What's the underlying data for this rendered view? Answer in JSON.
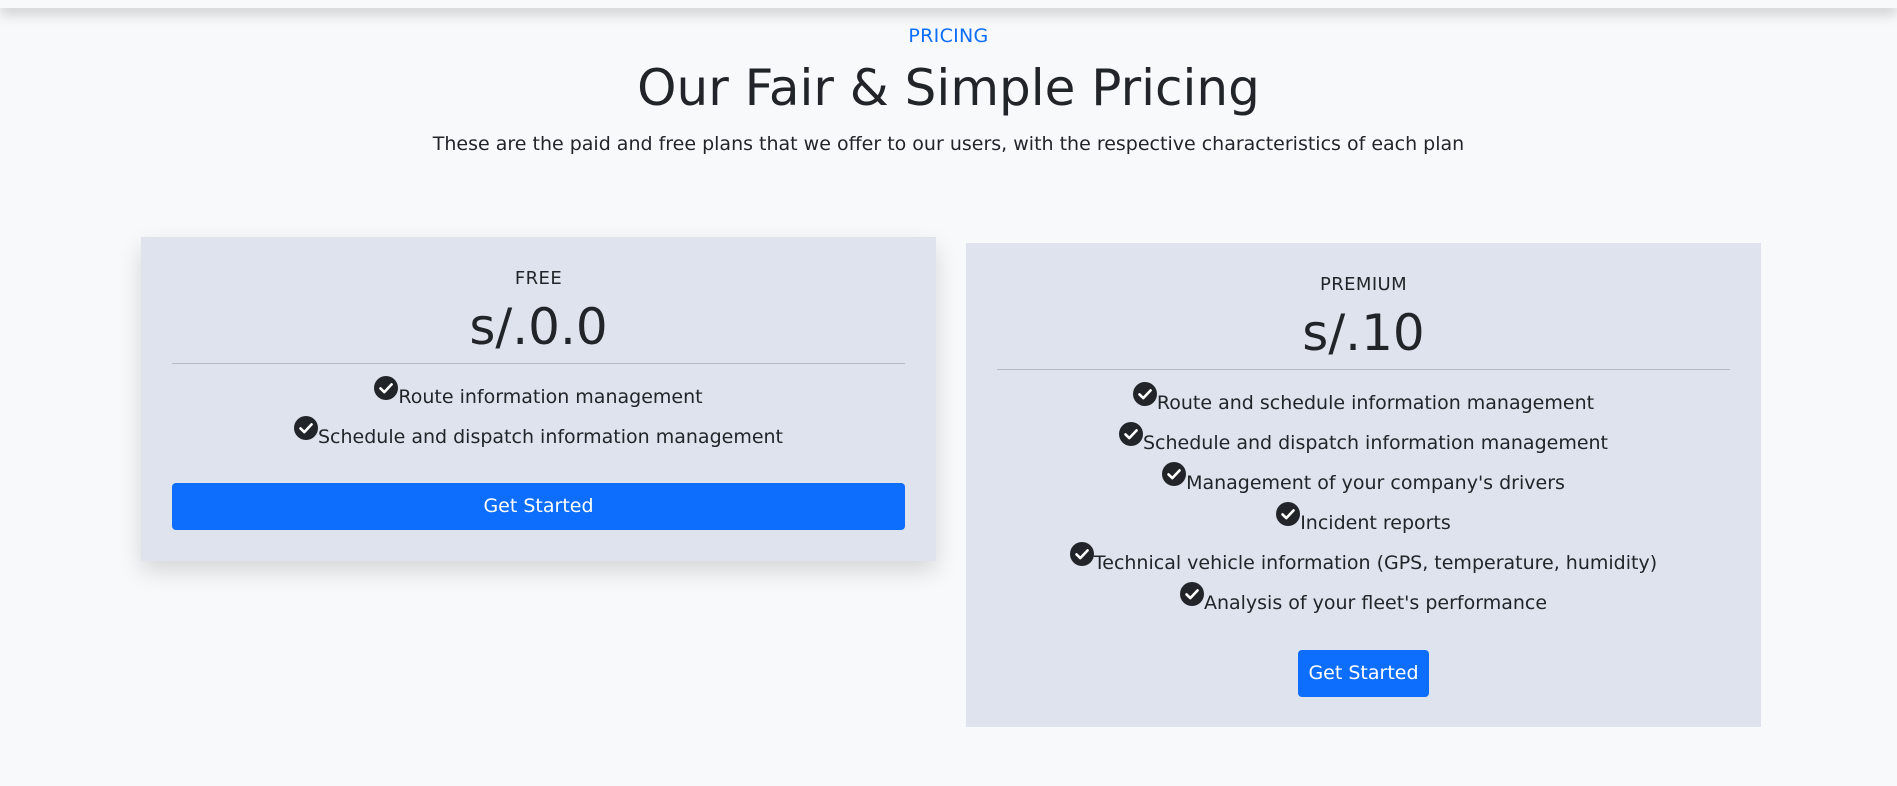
{
  "header": {
    "eyebrow": "PRICING",
    "title": "Our Fair & Simple Pricing",
    "subtitle": "These are the paid and free plans that we offer to our users, with the respective characteristics of each plan"
  },
  "plans": [
    {
      "name": "FREE",
      "price": "s/.0.0",
      "features": [
        "Route information management",
        "Schedule and dispatch information management"
      ],
      "cta_label": "Get Started"
    },
    {
      "name": "PREMIUM",
      "price": "s/.10",
      "features": [
        "Route and schedule information management",
        "Schedule and dispatch information management",
        "Management of your company's drivers",
        "Incident reports",
        "Technical vehicle information (GPS, temperature, humidity)",
        "Analysis of your fleet's performance"
      ],
      "cta_label": "Get Started"
    }
  ],
  "icons": {
    "feature_check": "check-circle-icon"
  },
  "colors": {
    "accent": "#0d6efd",
    "card_background": "#dee3ed",
    "page_background": "#f8f9fb",
    "text": "#212529"
  }
}
